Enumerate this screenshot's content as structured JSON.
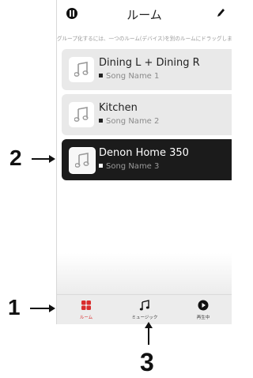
{
  "header": {
    "title": "ルーム",
    "instruction": "グループ化するには、一つのルーム(デバイス)を別のルームにドラッグします"
  },
  "rooms": [
    {
      "name": "Dining L + Dining R",
      "song": "Song Name 1",
      "active": false
    },
    {
      "name": "Kitchen",
      "song": "Song Name 2",
      "active": false
    },
    {
      "name": "Denon Home 350",
      "song": "Song Name 3",
      "active": true
    }
  ],
  "tabs": [
    {
      "label": "ルーム",
      "icon": "rooms-icon",
      "active": true
    },
    {
      "label": "ミュージック",
      "icon": "music-note-icon",
      "active": false
    },
    {
      "label": "再生中",
      "icon": "play-circle-icon",
      "active": false
    }
  ],
  "callouts": {
    "one": "1",
    "two": "2",
    "three": "3"
  },
  "colors": {
    "accent": "#d92e2e",
    "active_row": "#1b1b1b",
    "row": "#e9e9e9"
  }
}
